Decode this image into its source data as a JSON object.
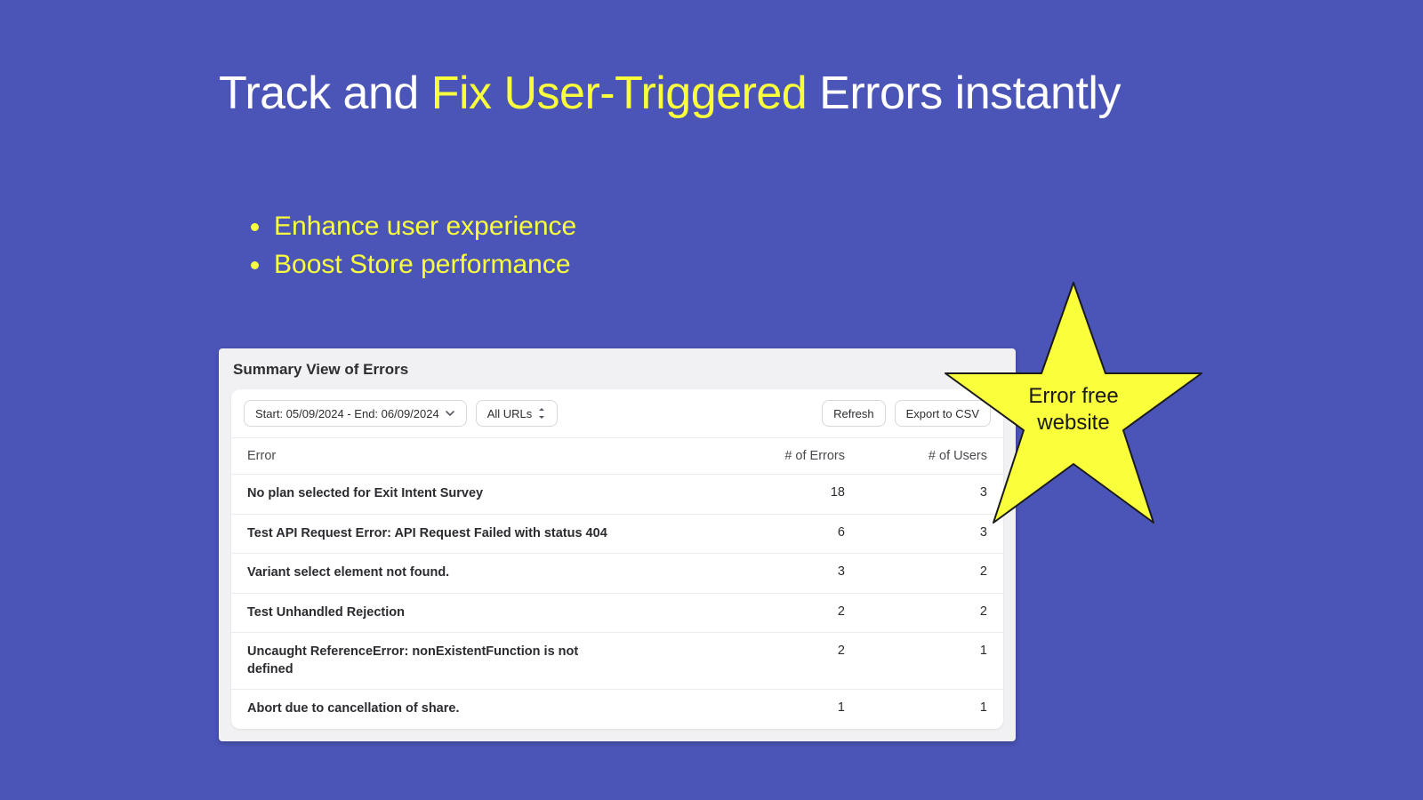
{
  "headline": {
    "part1": "Track and ",
    "accent": "Fix User-Triggered",
    "part2": " Errors instantly"
  },
  "bullets": [
    "Enhance user experience",
    "Boost Store performance"
  ],
  "panel": {
    "title": "Summary View of Errors",
    "date_range_label": "Start: 05/09/2024 - End: 06/09/2024",
    "url_filter_label": "All URLs",
    "refresh_label": "Refresh",
    "export_label": "Export to CSV",
    "columns": {
      "error": "Error",
      "num_errors": "# of Errors",
      "num_users": "# of Users"
    },
    "rows": [
      {
        "error": "No plan selected for Exit Intent Survey",
        "num_errors": "18",
        "num_users": "3"
      },
      {
        "error": "Test API Request Error: API Request Failed with status 404",
        "num_errors": "6",
        "num_users": "3"
      },
      {
        "error": "Variant select element not found.",
        "num_errors": "3",
        "num_users": "2"
      },
      {
        "error": "Test Unhandled Rejection",
        "num_errors": "2",
        "num_users": "2"
      },
      {
        "error": "Uncaught ReferenceError: nonExistentFunction is not defined",
        "num_errors": "2",
        "num_users": "1"
      },
      {
        "error": "Abort due to cancellation of share.",
        "num_errors": "1",
        "num_users": "1"
      }
    ]
  },
  "star_badge": {
    "line1": "Error free",
    "line2": "website"
  }
}
